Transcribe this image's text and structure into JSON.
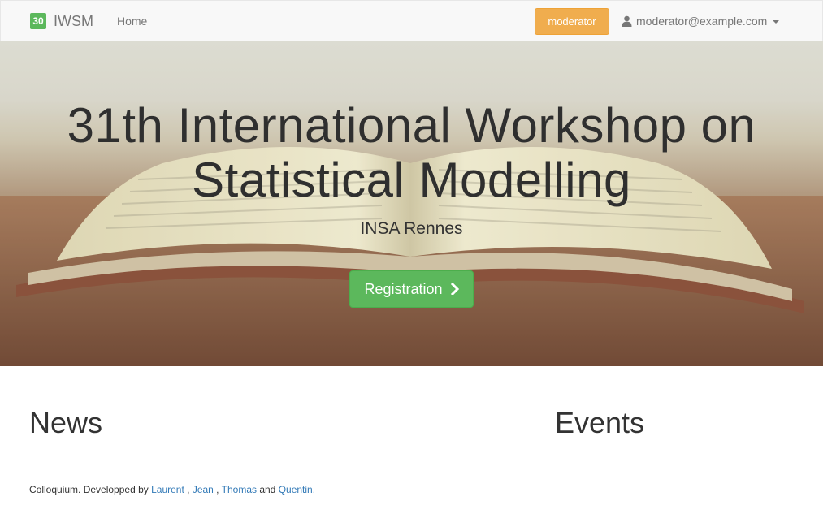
{
  "navbar": {
    "brand_badge": "30",
    "brand_name": "IWSM",
    "home_label": "Home",
    "role_label": "moderator",
    "user_email": "moderator@example.com"
  },
  "hero": {
    "title_line1": "31th International Workshop on",
    "title_line2": "Statistical Modelling",
    "subtitle": "INSA Rennes",
    "cta_label": "Registration"
  },
  "sections": {
    "news_heading": "News",
    "events_heading": "Events"
  },
  "footer": {
    "prefix": "Colloquium. Developped by ",
    "authors": [
      "Laurent",
      "Jean",
      "Thomas",
      "Quentin"
    ],
    "sep1": " , ",
    "sep2": " , ",
    "sep3": " and ",
    "end": "."
  },
  "colors": {
    "brand_badge": "#5cb85c",
    "role_button": "#f0ad4e",
    "cta_button": "#5cb85c",
    "link": "#337ab7"
  }
}
